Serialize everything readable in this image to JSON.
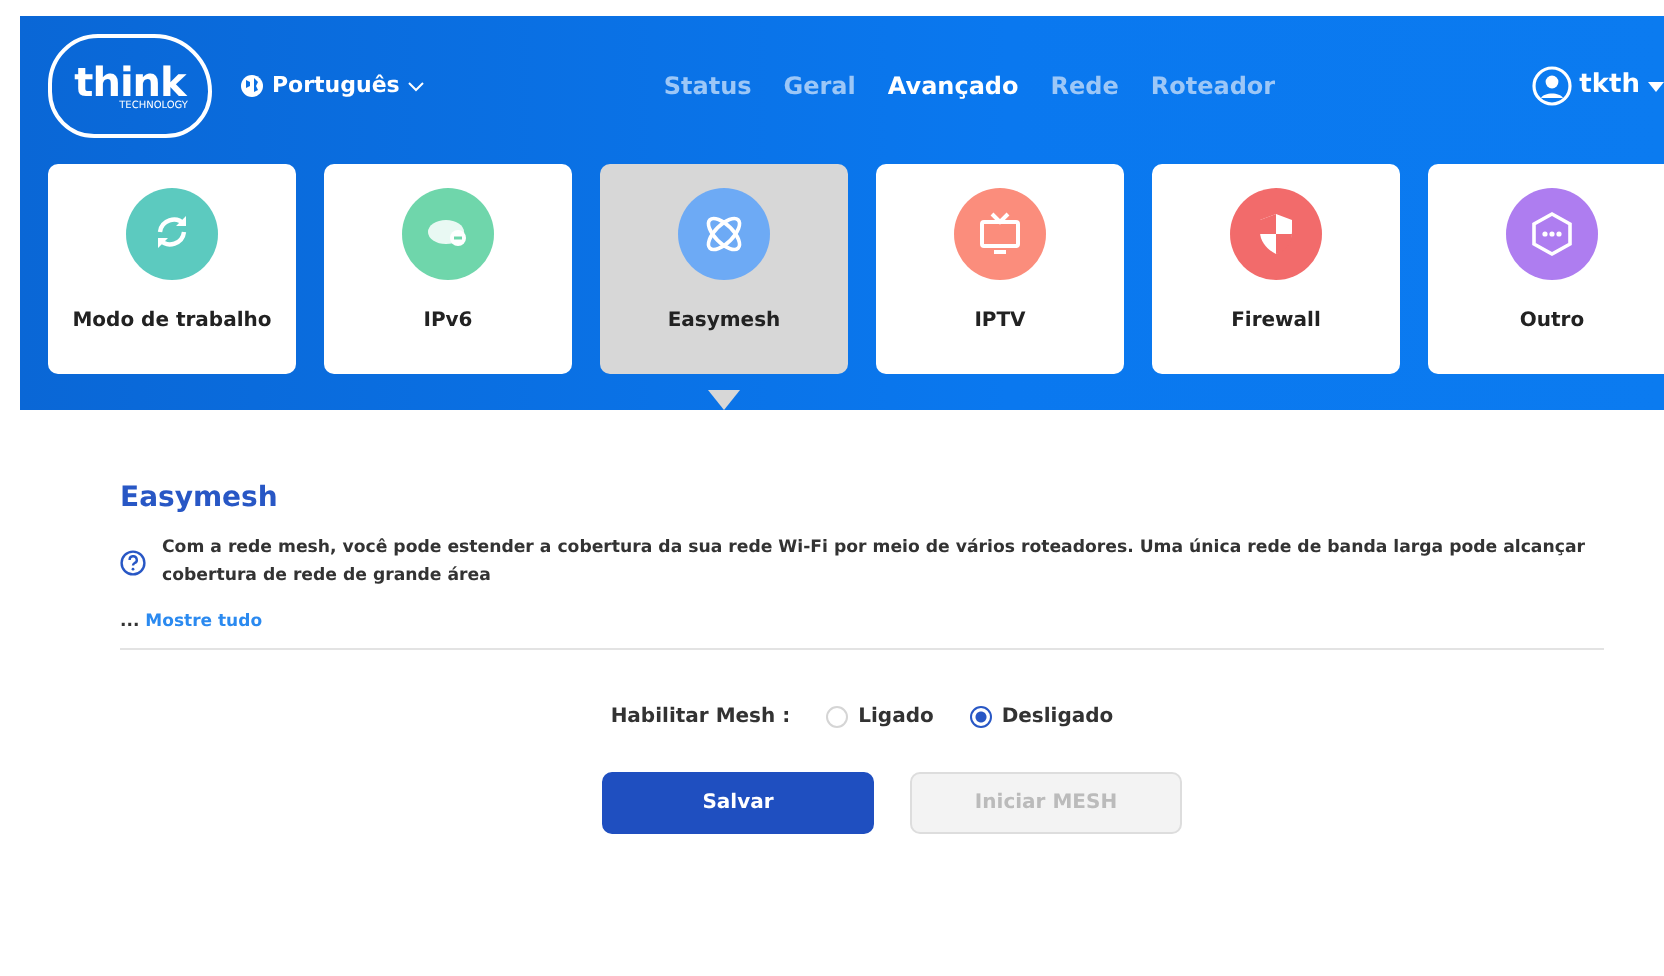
{
  "header": {
    "logo": {
      "name": "think",
      "tagline": "TECHNOLOGY"
    },
    "language": "Português",
    "nav": [
      {
        "label": "Status",
        "selected": false
      },
      {
        "label": "Geral",
        "selected": false
      },
      {
        "label": "Avançado",
        "selected": true
      },
      {
        "label": "Rede",
        "selected": false
      },
      {
        "label": "Roteador",
        "selected": false
      }
    ],
    "user": "tkth"
  },
  "tiles": [
    {
      "label": "Modo de trabalho",
      "kind": "refresh",
      "color": "#5ccabf",
      "selected": false
    },
    {
      "label": "IPv6",
      "kind": "ipv6",
      "color": "#6fd6ab",
      "selected": false
    },
    {
      "label": "Easymesh",
      "kind": "mesh",
      "color": "#6daaf5",
      "selected": true
    },
    {
      "label": "IPTV",
      "kind": "tv",
      "color": "#fb8d7c",
      "selected": false
    },
    {
      "label": "Firewall",
      "kind": "shield",
      "color": "#f26b6b",
      "selected": false
    },
    {
      "label": "Outro",
      "kind": "more",
      "color": "#ae7df0",
      "selected": false
    }
  ],
  "panel": {
    "title": "Easymesh",
    "description": "Com a rede mesh, você pode estender a cobertura da sua rede Wi-Fi por meio de vários roteadores. Uma única rede de banda larga pode alcançar cobertura de rede de grande área",
    "more_prefix": "...",
    "more_link": "Mostre tudo",
    "field_label": "Habilitar Mesh :",
    "options": [
      {
        "label": "Ligado",
        "selected": false
      },
      {
        "label": "Desligado",
        "selected": true
      }
    ],
    "buttons": [
      {
        "label": "Salvar",
        "disabled": false
      },
      {
        "label": "Iniciar MESH",
        "disabled": true
      }
    ]
  }
}
